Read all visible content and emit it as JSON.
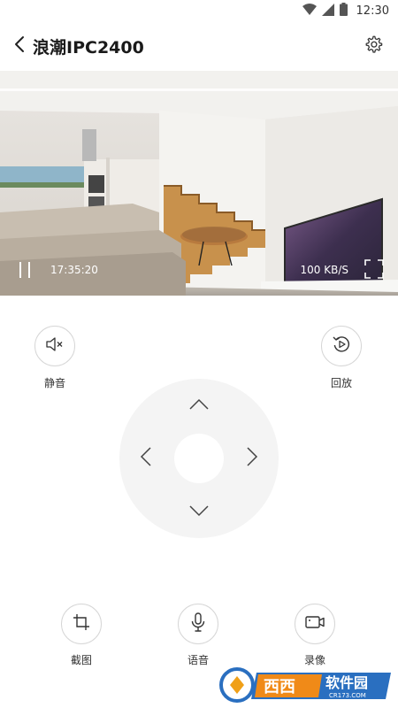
{
  "status_bar": {
    "time": "12:30"
  },
  "header": {
    "title": "浪潮IPC2400"
  },
  "video": {
    "timestamp": "17:35:20",
    "bitrate": "100 KB/S"
  },
  "controls": {
    "mute_label": "静音",
    "playback_label": "回放",
    "screenshot_label": "截图",
    "voice_label": "语音",
    "record_label": "录像"
  },
  "watermark": {
    "text": "西西软件园",
    "sub": "CR173.COM"
  },
  "colors": {
    "accent": "#000000",
    "ptz_bg": "#f4f4f4",
    "button_border": "#d6d6d6"
  }
}
